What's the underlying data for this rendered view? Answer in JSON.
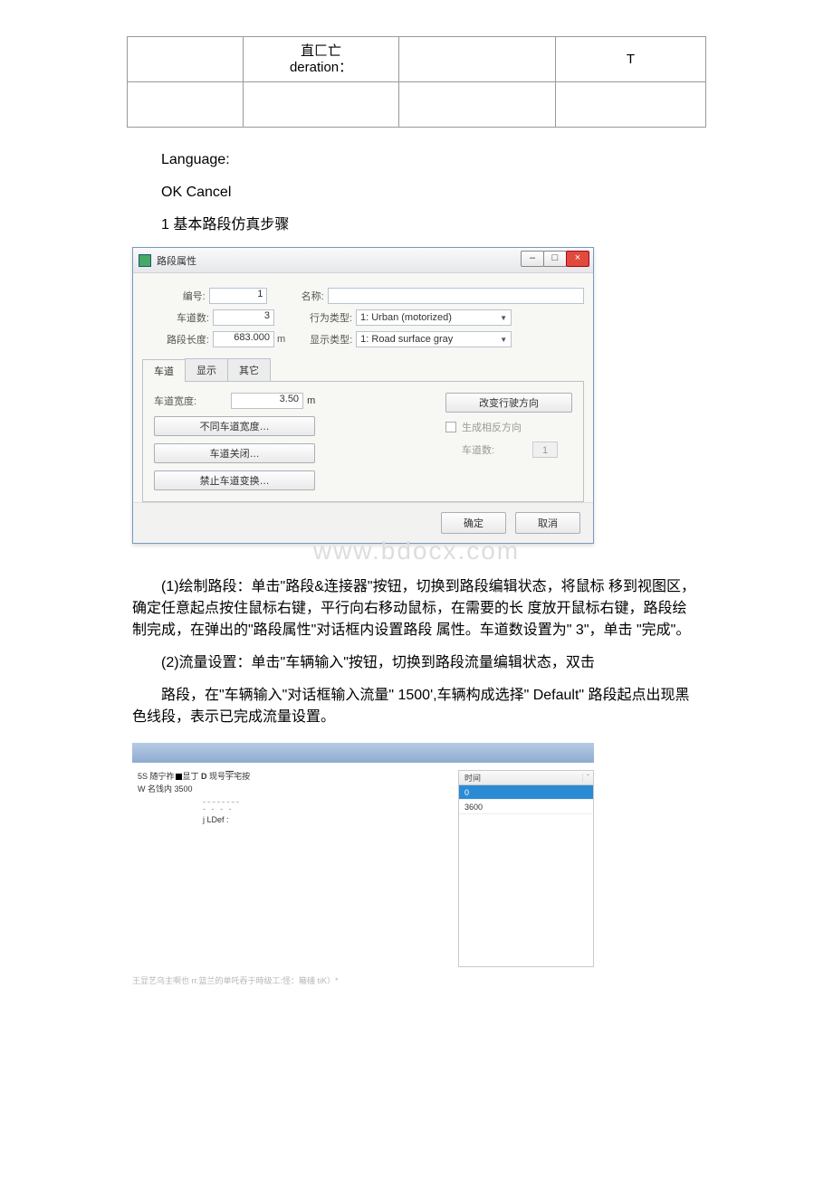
{
  "top_table": {
    "r1c2a": "直匚亡",
    "r1c2b": "deration：",
    "r1c4": "T"
  },
  "text": {
    "language": "Language:",
    "ok_cancel": "OK Cancel",
    "heading": "1 基本路段仿真步骤",
    "para1": "(1)绘制路段：单击\"路段&连接器\"按钮，切换到路段编辑状态，将鼠标 移到视图区， 确定任意起点按住鼠标右键，平行向右移动鼠标，在需要的长 度放开鼠标右键，路段绘制完成，在弹出的\"路段属性\"对话框内设置路段 属性。车道数设置为\" 3\"，单击 \"完成\"。",
    "para2": "(2)流量设置：单击\"车辆输入\"按钮，切换到路段流量编辑状态，双击",
    "para3": "路段，在\"车辆输入\"对话框输入流量\" 1500',车辆构成选择\" Default\" 路段起点出现黑色线段，表示已完成流量设置。"
  },
  "dialog": {
    "title": "路段属性",
    "labels": {
      "id": "编号:",
      "name": "名称:",
      "lanes": "车道数:",
      "behavior": "行为类型:",
      "length": "路段长度:",
      "display": "显示类型:"
    },
    "values": {
      "id": "1",
      "name": "",
      "lanes": "3",
      "behavior": "1: Urban (motorized)",
      "length_num": "683.000",
      "length_unit": "m",
      "display": "1: Road surface gray"
    },
    "tabs": {
      "t1": "车道",
      "t2": "显示",
      "t3": "其它"
    },
    "pane": {
      "lane_width_label": "车道宽度:",
      "lane_width_value": "3.50",
      "lane_width_unit": "m",
      "btn_diff_width": "不同车道宽度…",
      "btn_lane_close": "车道关闭…",
      "btn_lane_forbid": "禁止车道变换…",
      "btn_reverse": "改变行驶方向",
      "chk_gen_reverse": "生成相反方向",
      "lbl_lane_count": "车道数:",
      "lane_count_value": "1",
      "ok": "确定",
      "cancel": "取消"
    },
    "winbtns": {
      "min": "–",
      "max": "□",
      "close": "×"
    }
  },
  "watermark": "www.bdocx.com",
  "shot2": {
    "line1_parts": [
      "5S 随宁祚",
      "显丁 ",
      "D",
      " 现号",
      "宇",
      "宅按"
    ],
    "line2": "W 名饯内 3500",
    "dash2": "- - - -",
    "ldef": "j LDef :",
    "table": {
      "header": "时间",
      "rows": [
        "0",
        "3600"
      ]
    }
  },
  "footnote": "王显艺乌主啊也 rr.篮兰的单吒吞于時级工:怪：簸碊 tiK）*"
}
